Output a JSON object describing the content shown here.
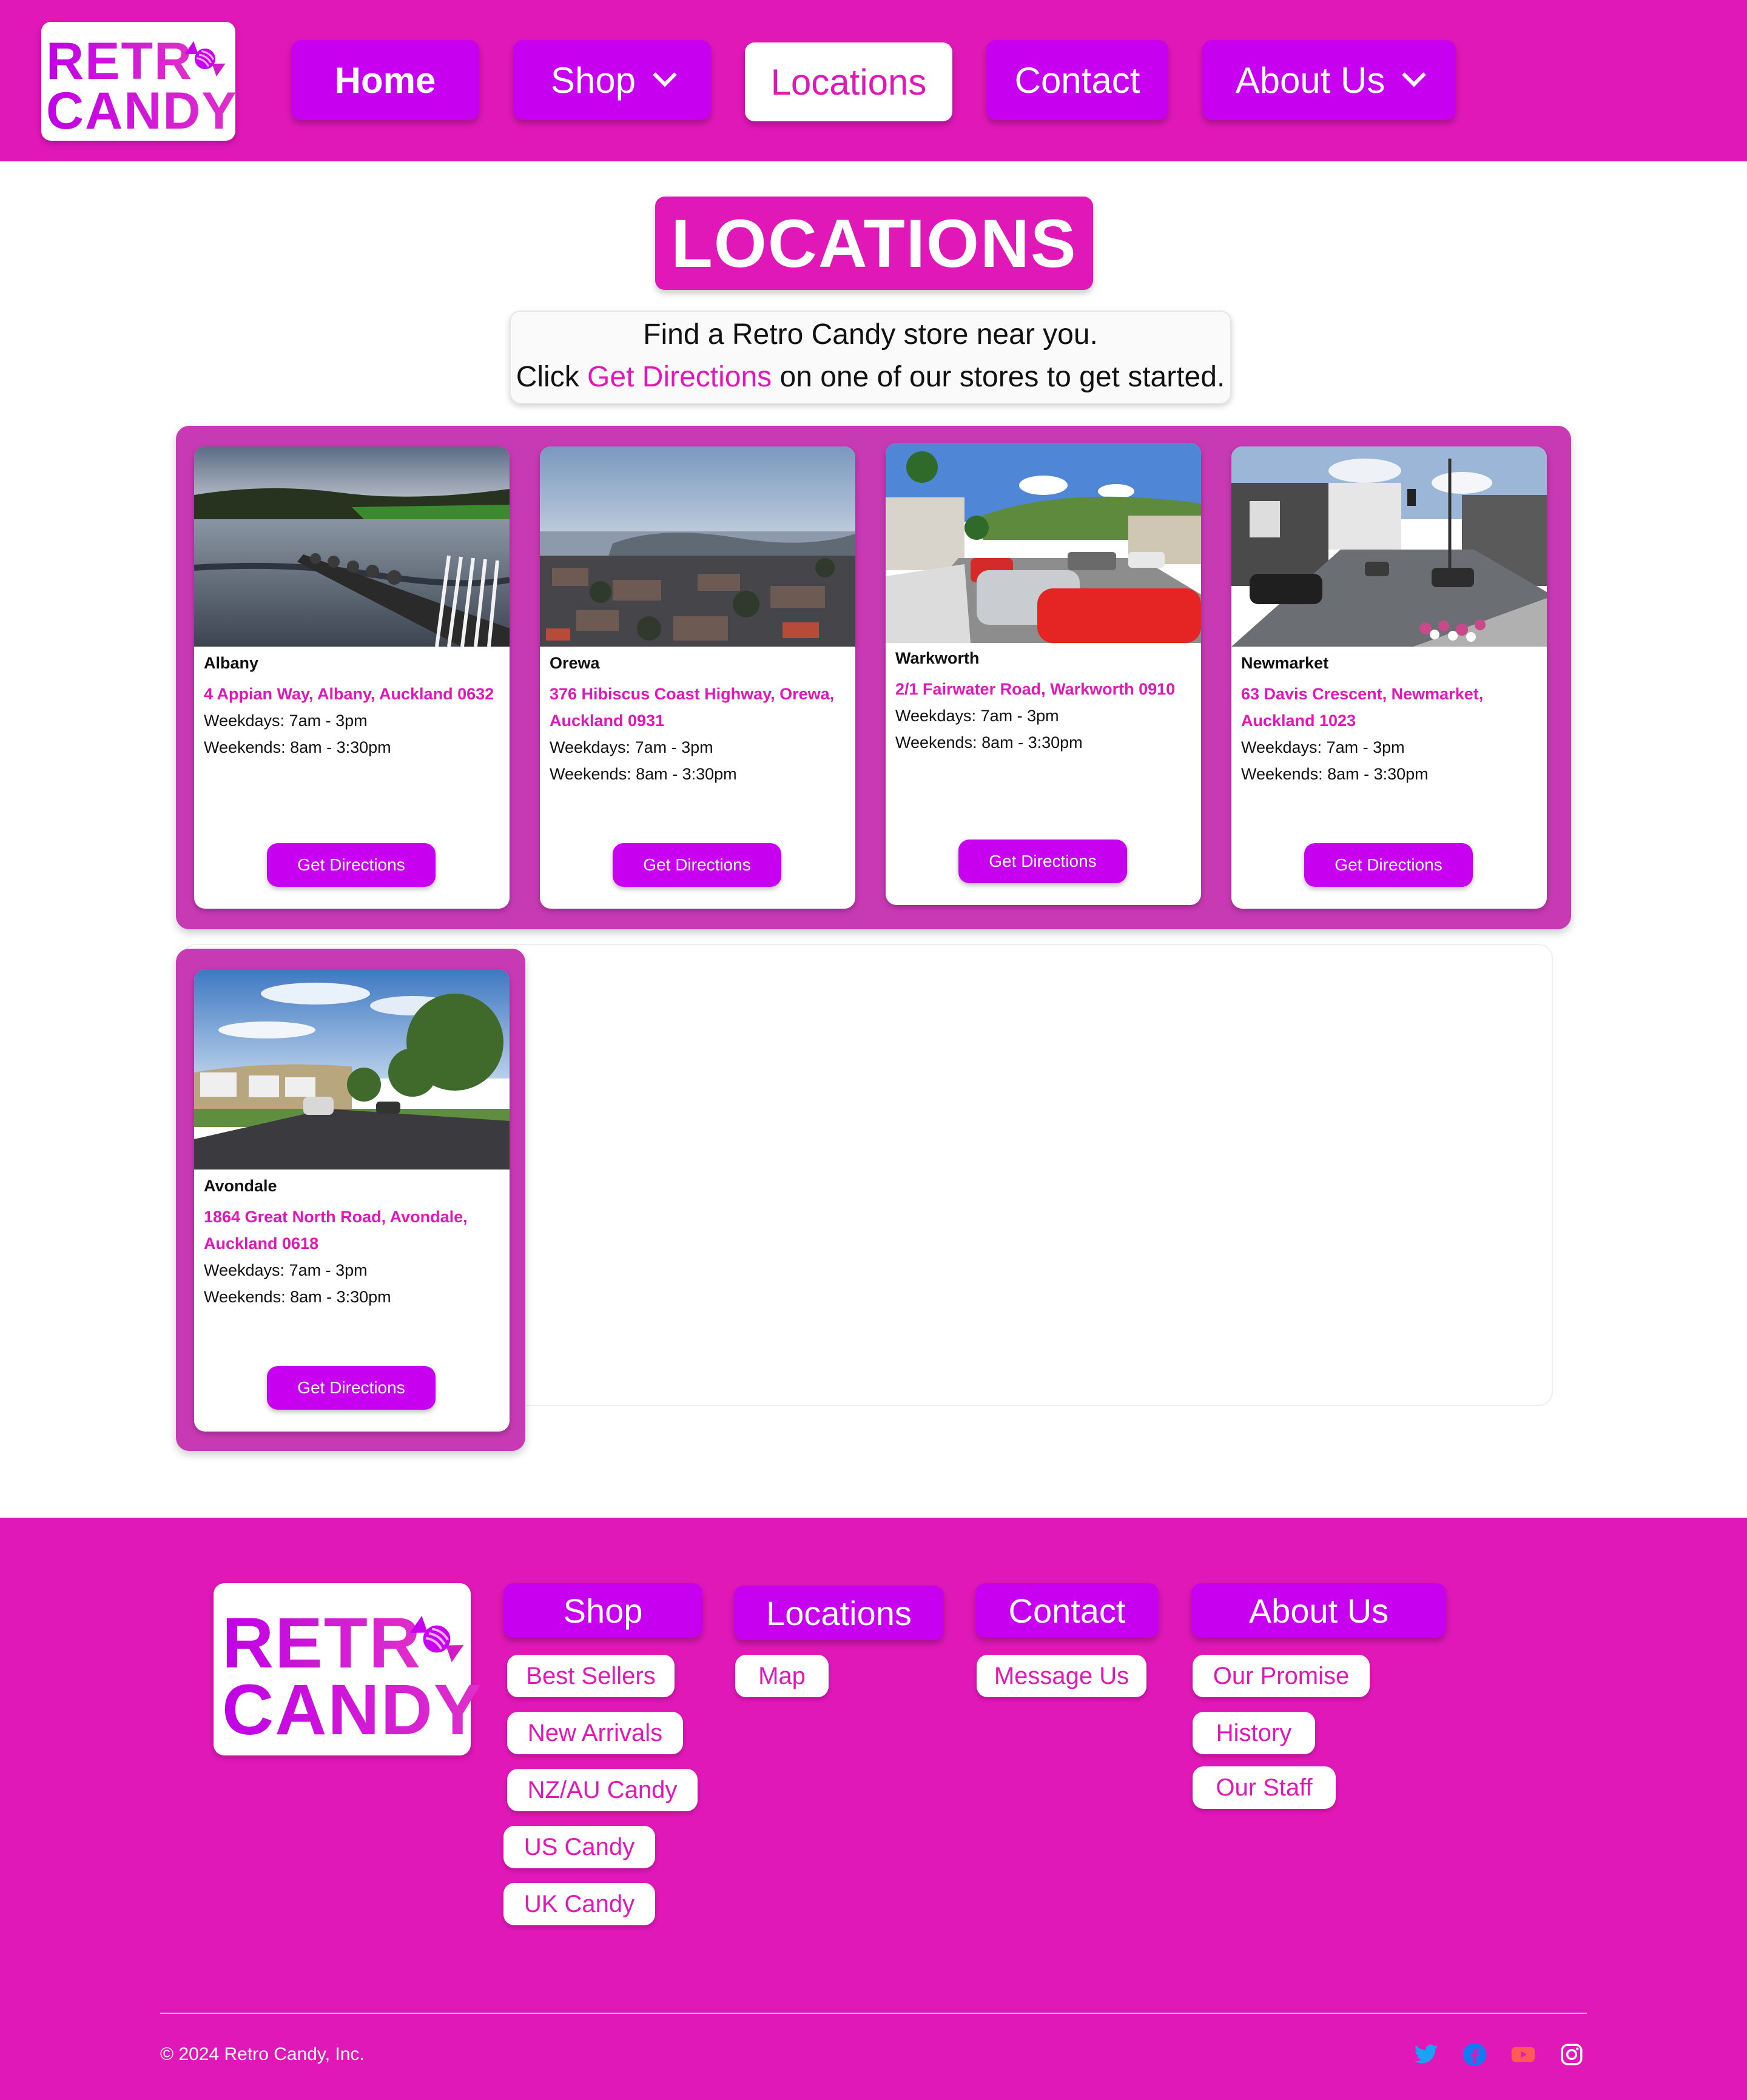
{
  "brand": {
    "logo_line1": "RETR",
    "logo_line2": "CANDY"
  },
  "colors": {
    "primary": "#e018b8",
    "button": "#c800f0",
    "card_frame": "#c83ab4"
  },
  "nav": {
    "items": [
      {
        "label": "Home",
        "has_dropdown": false,
        "active": false
      },
      {
        "label": "Shop",
        "has_dropdown": true,
        "active": false
      },
      {
        "label": "Locations",
        "has_dropdown": false,
        "active": true
      },
      {
        "label": "Contact",
        "has_dropdown": false,
        "active": false
      },
      {
        "label": "About Us",
        "has_dropdown": true,
        "active": false
      }
    ]
  },
  "page": {
    "title": "LOCATIONS",
    "intro_line1": "Find a Retro Candy store near you.",
    "intro_line2_before": "Click ",
    "intro_line2_link": "Get Directions",
    "intro_line2_after": " on one of our stores to get started."
  },
  "locations": [
    {
      "name": "Albany",
      "address": "4 Appian Way, Albany, Auckland 0632",
      "weekdays": "Weekdays: 7am - 3pm",
      "weekends": "Weekends: 8am - 3:30pm",
      "button": "Get Directions"
    },
    {
      "name": "Orewa",
      "address": "376 Hibiscus Coast Highway, Orewa, Auckland 0931",
      "weekdays": "Weekdays: 7am - 3pm",
      "weekends": "Weekends: 8am - 3:30pm",
      "button": "Get Directions"
    },
    {
      "name": "Warkworth",
      "address": "2/1 Fairwater Road, Warkworth 0910",
      "weekdays": "Weekdays: 7am - 3pm",
      "weekends": "Weekends: 8am - 3:30pm",
      "button": "Get Directions"
    },
    {
      "name": "Newmarket",
      "address": "63 Davis Crescent, Newmarket, Auckland 1023",
      "weekdays": "Weekdays: 7am - 3pm",
      "weekends": "Weekends: 8am - 3:30pm",
      "button": "Get Directions"
    },
    {
      "name": "Avondale",
      "address": "1864 Great North Road, Avondale, Auckland 0618",
      "weekdays": "Weekdays: 7am - 3pm",
      "weekends": "Weekends: 8am - 3:30pm",
      "button": "Get Directions"
    }
  ],
  "footer": {
    "logo_line1": "RETR",
    "logo_line2": "CANDY",
    "columns": [
      {
        "heading": "Shop",
        "links": [
          "Best Sellers",
          "New Arrivals",
          "NZ/AU Candy",
          "US Candy",
          "UK Candy"
        ]
      },
      {
        "heading": "Locations",
        "links": [
          "Map"
        ]
      },
      {
        "heading": "Contact",
        "links": [
          "Message Us"
        ]
      },
      {
        "heading": "About Us",
        "links": [
          "Our Promise",
          "History",
          "Our Staff"
        ]
      }
    ],
    "copyright": "© 2024 Retro Candy, Inc.",
    "social": [
      {
        "icon": "twitter-icon",
        "color": "#1da1f2"
      },
      {
        "icon": "facebook-icon",
        "color": "#1877f2"
      },
      {
        "icon": "youtube-icon",
        "color": "#ff5a5a"
      },
      {
        "icon": "instagram-icon",
        "color": "#ffffff"
      }
    ]
  }
}
